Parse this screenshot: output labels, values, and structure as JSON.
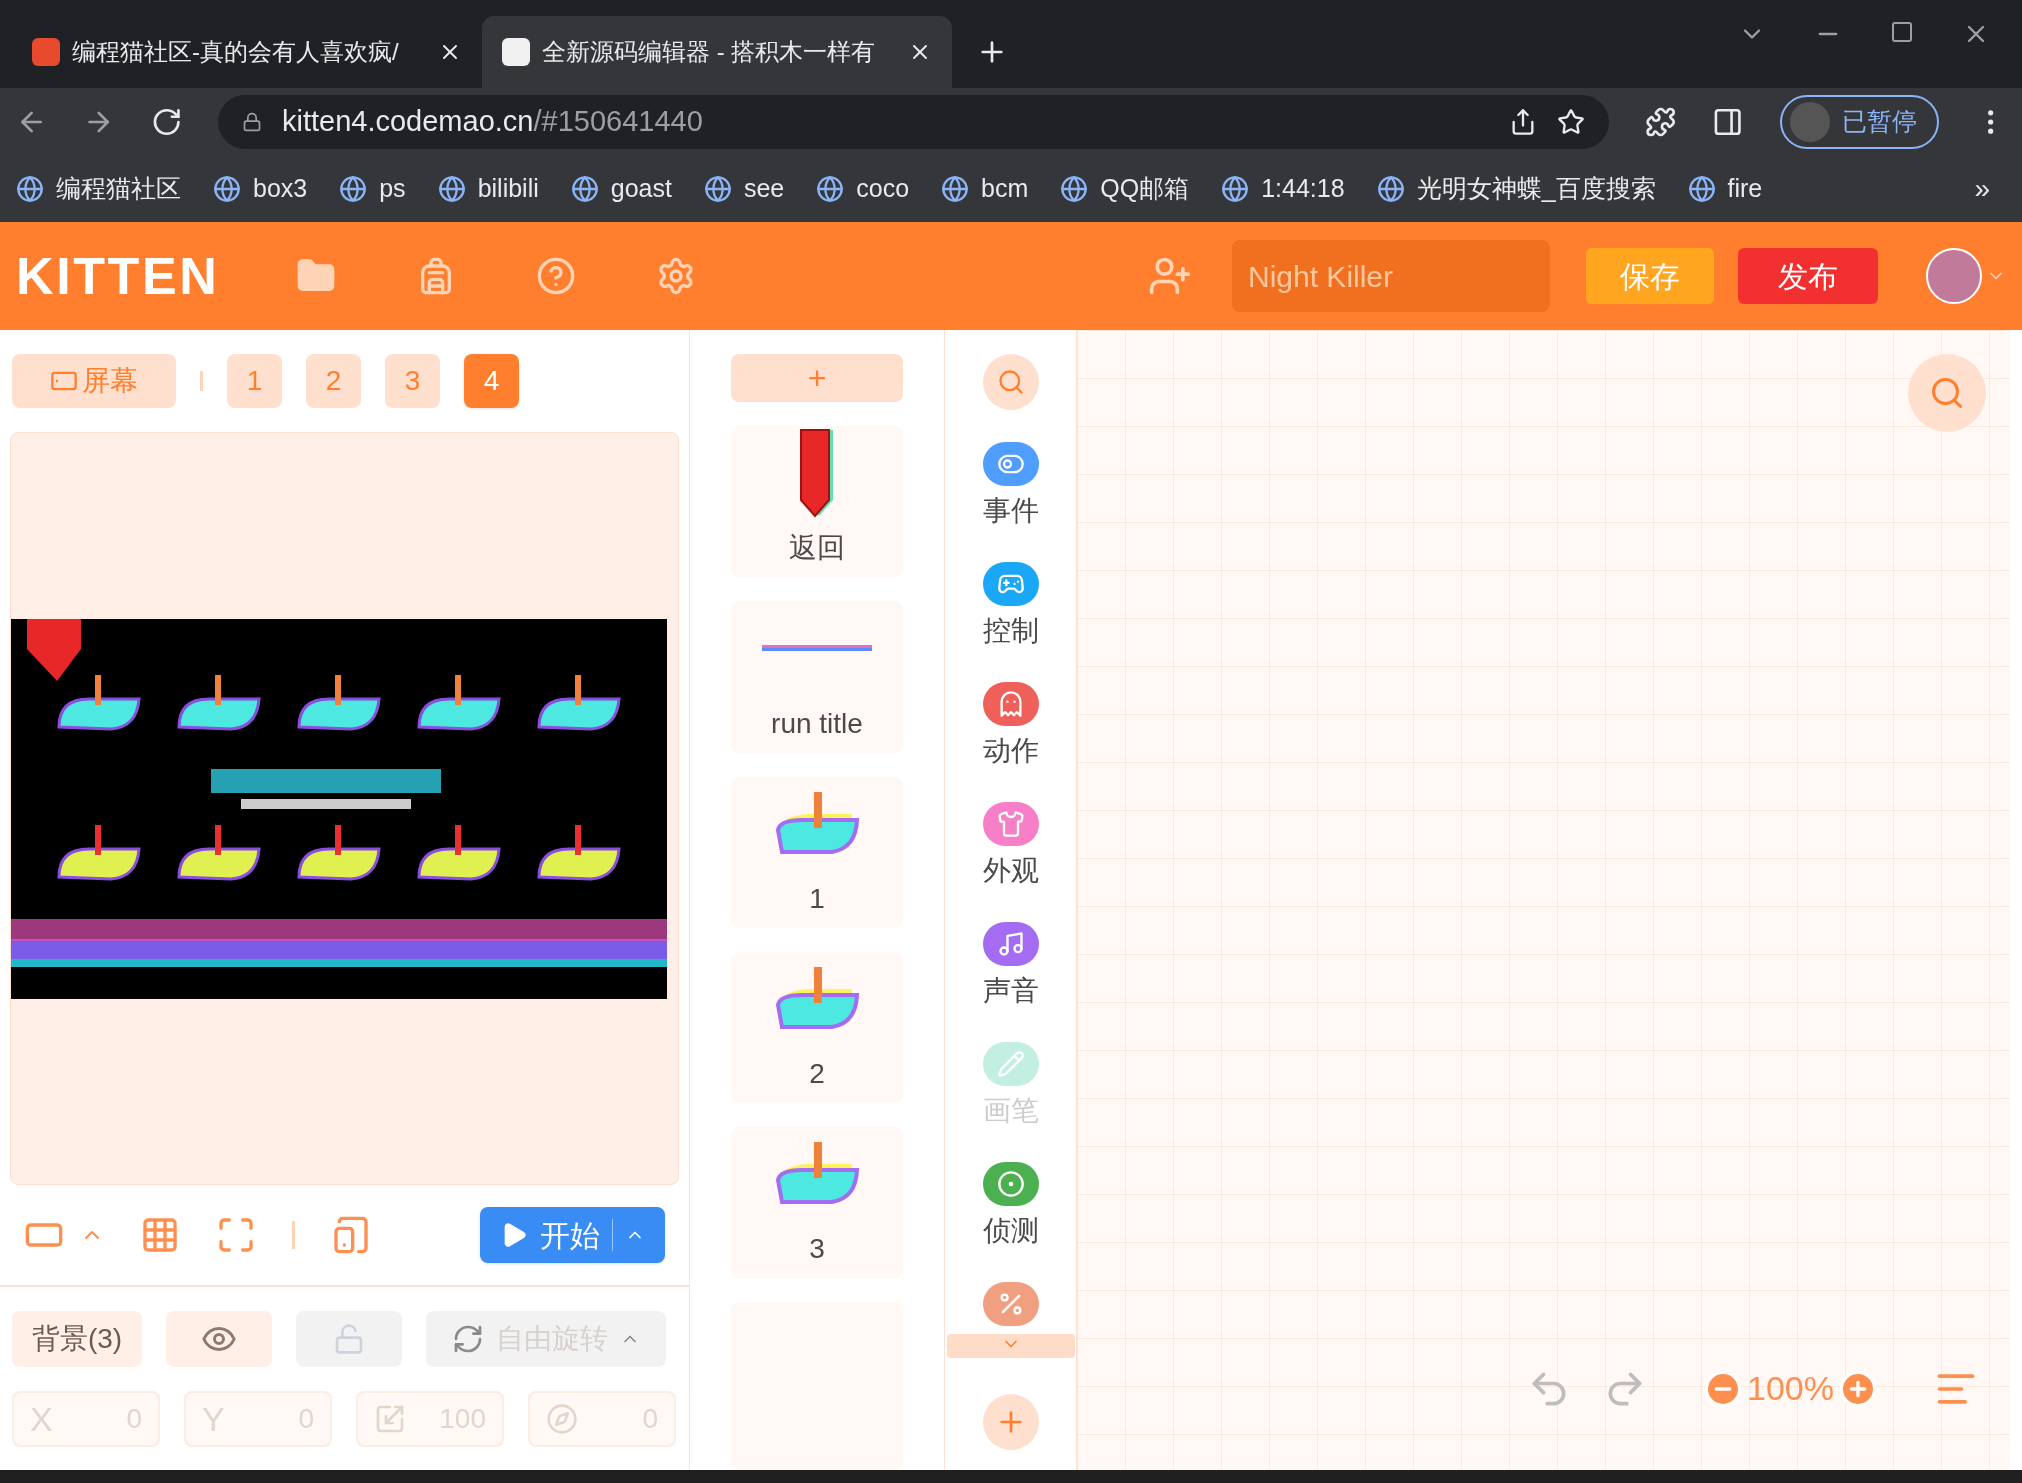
{
  "browser": {
    "tabs": [
      {
        "title": "编程猫社区-真的会有人喜欢疯/",
        "selected": false
      },
      {
        "title": "全新源码编辑器 - 搭积木一样有",
        "selected": true
      }
    ],
    "url_host": "kitten4.codemao.cn",
    "url_path": "/#150641440",
    "profile": "已暂停",
    "bookmarks": [
      "编程猫社区",
      "box3",
      "ps",
      "bilibili",
      "goast",
      "see",
      "coco",
      "bcm",
      "QQ邮箱",
      "1:44:18",
      "光明女神蝶_百度搜索",
      "fire"
    ],
    "more": "»"
  },
  "header": {
    "logo": "KITTEN",
    "project_name": "Night Killer",
    "save": "保存",
    "publish": "发布"
  },
  "stage": {
    "screen_button": "屏幕",
    "scenes": [
      {
        "label": "1",
        "selected": false
      },
      {
        "label": "2",
        "selected": false
      },
      {
        "label": "3",
        "selected": false
      },
      {
        "label": "4",
        "selected": true
      }
    ],
    "start_button": "开始"
  },
  "properties": {
    "background": "背景(3)",
    "rotation": "自由旋转",
    "fields": [
      {
        "kind": "x",
        "label": "X",
        "value": "0"
      },
      {
        "kind": "y",
        "label": "Y",
        "value": "0"
      },
      {
        "kind": "size",
        "value": "100"
      },
      {
        "kind": "direction",
        "value": "0"
      }
    ]
  },
  "sprites": {
    "add": "+",
    "items": [
      {
        "kind": "back",
        "name": "返回"
      },
      {
        "kind": "title",
        "name": "run title"
      },
      {
        "kind": "run",
        "name": "1"
      },
      {
        "kind": "run",
        "name": "2"
      },
      {
        "kind": "run",
        "name": "3"
      }
    ]
  },
  "categories": [
    {
      "kind": "toggle",
      "label": "事件",
      "color": "#4f9dff",
      "disabled": false
    },
    {
      "kind": "gamepad",
      "label": "控制",
      "color": "#1aa7f5",
      "disabled": false
    },
    {
      "kind": "ghost",
      "label": "动作",
      "color": "#f0605a",
      "disabled": false
    },
    {
      "kind": "shirt",
      "label": "外观",
      "color": "#f77fc7",
      "disabled": false
    },
    {
      "kind": "music",
      "label": "声音",
      "color": "#a36cf2",
      "disabled": false
    },
    {
      "kind": "pen",
      "label": "画笔",
      "color": "#c2efe2",
      "disabled": true
    },
    {
      "kind": "target",
      "label": "侦测",
      "color": "#4caf50",
      "disabled": false
    },
    {
      "kind": "math",
      "color": "#f0a080",
      "disabled": false
    }
  ],
  "canvas": {
    "zoom": "100%"
  }
}
